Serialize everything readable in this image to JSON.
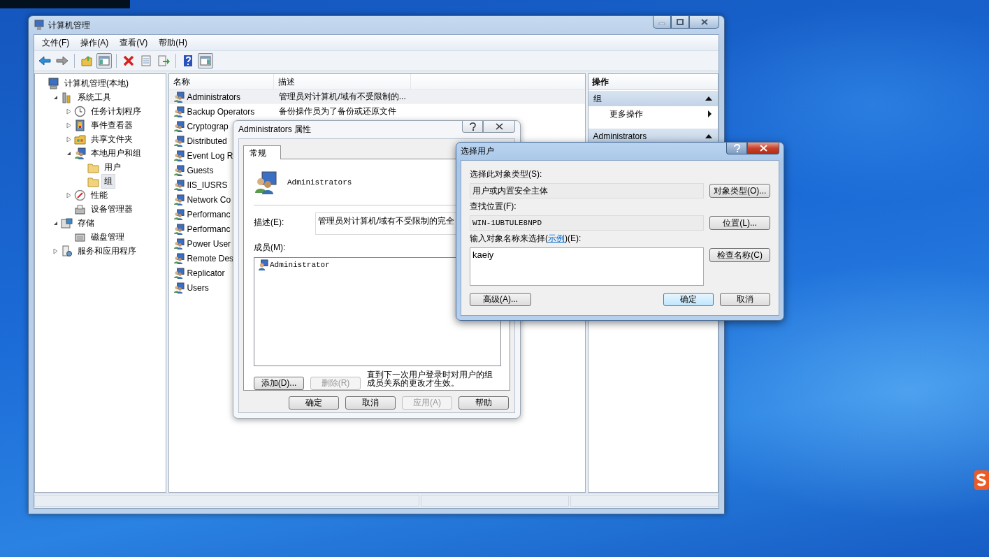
{
  "main_window": {
    "title": "计算机管理",
    "menu": [
      "文件(F)",
      "操作(A)",
      "查看(V)",
      "帮助(H)"
    ],
    "toolbar": [
      [
        {
          "kind": "back",
          "on": false
        },
        {
          "kind": "forward",
          "on": false
        }
      ],
      [
        {
          "kind": "up",
          "on": false
        },
        {
          "kind": "tree",
          "on": true
        }
      ],
      [
        {
          "kind": "delete",
          "on": false
        },
        {
          "kind": "properties",
          "on": false
        },
        {
          "kind": "export",
          "on": false
        }
      ],
      [
        {
          "kind": "help",
          "on": false
        },
        {
          "kind": "actions",
          "on": true
        }
      ]
    ],
    "tree": [
      {
        "label": "计算机管理(本地)",
        "kind": "computer",
        "selected": false,
        "children": [
          {
            "label": "系统工具",
            "kind": "tools",
            "expanded": true,
            "selected": false,
            "children": [
              {
                "label": "任务计划程序",
                "kind": "clock",
                "expanded": false,
                "selected": false
              },
              {
                "label": "事件查看器",
                "kind": "event",
                "expanded": false,
                "selected": false
              },
              {
                "label": "共享文件夹",
                "kind": "share",
                "expanded": false,
                "selected": false
              },
              {
                "label": "本地用户和组",
                "kind": "users",
                "expanded": true,
                "selected": false,
                "children": [
                  {
                    "label": "用户",
                    "kind": "folder",
                    "selected": false
                  },
                  {
                    "label": "组",
                    "kind": "folder",
                    "selected": true
                  }
                ]
              },
              {
                "label": "性能",
                "kind": "perf",
                "expanded": false,
                "selected": false
              },
              {
                "label": "设备管理器",
                "kind": "device",
                "selected": false
              }
            ]
          },
          {
            "label": "存储",
            "kind": "storage",
            "expanded": true,
            "selected": false,
            "children": [
              {
                "label": "磁盘管理",
                "kind": "disk",
                "selected": false
              }
            ]
          },
          {
            "label": "服务和应用程序",
            "kind": "services",
            "expanded": false,
            "selected": false
          }
        ]
      }
    ],
    "list": {
      "columns": [
        "名称",
        "描述"
      ],
      "rows": [
        {
          "name": "Administrators",
          "description": "管理员对计算机/域有不受限制的...",
          "selected": true
        },
        {
          "name": "Backup Operators",
          "description": "备份操作员为了备份或还原文件",
          "selected": false
        },
        {
          "name": "Cryptograp",
          "selected": false
        },
        {
          "name": "Distributed",
          "selected": false
        },
        {
          "name": "Event Log R",
          "selected": false
        },
        {
          "name": "Guests",
          "selected": false
        },
        {
          "name": "IIS_IUSRS",
          "selected": false
        },
        {
          "name": "Network Co",
          "selected": false
        },
        {
          "name": "Performanc",
          "selected": false
        },
        {
          "name": "Performanc",
          "selected": false
        },
        {
          "name": "Power User",
          "selected": false
        },
        {
          "name": "Remote Des",
          "selected": false
        },
        {
          "name": "Replicator",
          "selected": false
        },
        {
          "name": "Users",
          "selected": false
        }
      ]
    },
    "actions": {
      "title": "操作",
      "sections": [
        {
          "title": "组",
          "expanded": true,
          "items": [
            {
              "label": "更多操作",
              "submenu": true
            }
          ]
        },
        {
          "title": "Administrators",
          "expanded": true
        }
      ]
    }
  },
  "properties_dialog": {
    "title": "Administrators 属性",
    "tabs": [
      {
        "label": "常规",
        "selected": true
      }
    ],
    "group_name": "Administrators",
    "description_label": "描述(E):",
    "description": "管理员对计算机/域有不受限制的完全",
    "members_label": "成员(M):",
    "members": [
      "Administrator"
    ],
    "member_buttons": [
      {
        "label": "添加(D)...",
        "disabled": false
      },
      {
        "label": "删除(R)",
        "disabled": true
      }
    ],
    "note": "直到下一次用户登录时对用户的组成员关系的更改才生效。",
    "buttons": [
      {
        "label": "确定",
        "disabled": false
      },
      {
        "label": "取消",
        "disabled": false
      },
      {
        "label": "应用(A)",
        "disabled": true
      },
      {
        "label": "帮助",
        "disabled": false
      }
    ]
  },
  "select_dialog": {
    "title": "选择用户",
    "object_type_label": "选择此对象类型(S):",
    "object_type": "用户或内置安全主体",
    "object_type_button": "对象类型(O)...",
    "location_label": "查找位置(F):",
    "location": "WIN-1UBTULE8NPD",
    "location_button": "位置(L)...",
    "names_label": {
      "before": "输入对象名称来选择(",
      "link": "示例",
      "after": ")(E):"
    },
    "names": "kaeiy",
    "check_button": "检查名称(C)",
    "buttons": [
      {
        "label": "高级(A)...",
        "default": false
      },
      {
        "label": "确定",
        "default": true
      },
      {
        "label": "取消",
        "default": false
      }
    ]
  }
}
